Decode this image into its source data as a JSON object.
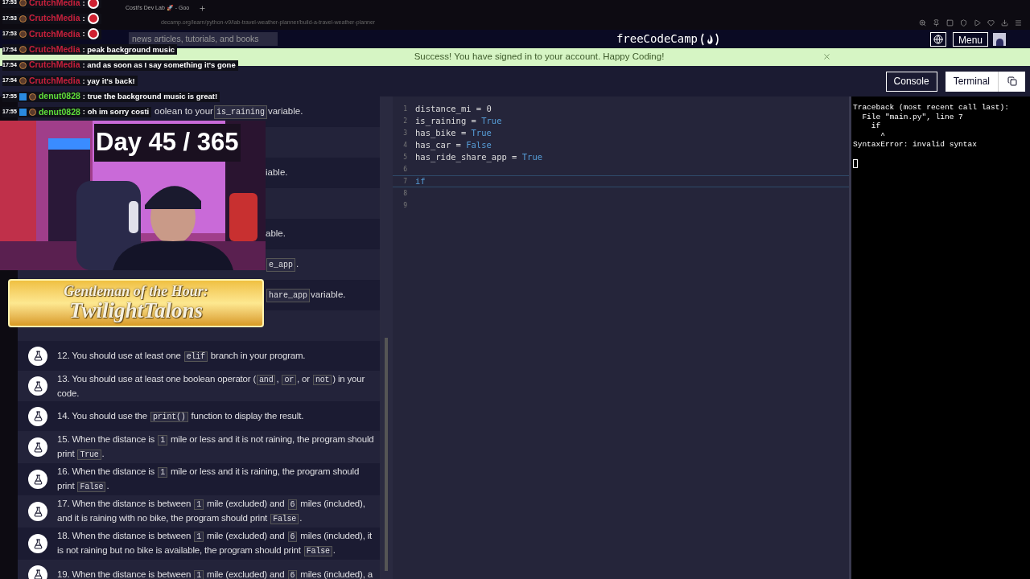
{
  "browser": {
    "tab_title": "Costi's Dev Lab 🚀 - Goo",
    "url": "decamp.org/learn/python-v9/lab-travel-weather-planner/build-a-travel-weather-planner"
  },
  "nav": {
    "search_placeholder": "news articles, tutorials, and books",
    "logo": "freeCodeCamp",
    "menu": "Menu"
  },
  "alert": {
    "text": "Success! You have signed in to your account. Happy Coding!"
  },
  "toolbar": {
    "panels": [
      {
        "label": "Console",
        "selected": false
      },
      {
        "label": "Terminal",
        "selected": true
      }
    ]
  },
  "tests": [
    {
      "kind": "clipped",
      "parts": [
        {
          "text": "oolean to your ",
          "code": false
        },
        {
          "text": "is_raining",
          "code": true
        },
        {
          "text": " variable.",
          "code": false
        }
      ]
    },
    {
      "kind": "covered"
    },
    {
      "kind": "fragment",
      "parts": [
        {
          "text": "iable.",
          "code": false
        }
      ]
    },
    {
      "kind": "covered"
    },
    {
      "kind": "fragment",
      "parts": [
        {
          "text": "able.",
          "code": false
        }
      ]
    },
    {
      "kind": "fragment",
      "parts": [
        {
          "text": "e_app",
          "code": true
        },
        {
          "text": ".",
          "code": false
        }
      ]
    },
    {
      "kind": "fragment",
      "parts": [
        {
          "text": "hare_app",
          "code": true
        },
        {
          "text": " variable.",
          "code": false
        }
      ]
    },
    {
      "kind": "covered"
    },
    {
      "kind": "full",
      "parts": [
        {
          "text": "12. You should use at least one ",
          "code": false
        },
        {
          "text": "elif",
          "code": true
        },
        {
          "text": " branch in your program.",
          "code": false
        }
      ]
    },
    {
      "kind": "full",
      "parts": [
        {
          "text": "13. You should use at least one boolean operator (",
          "code": false
        },
        {
          "text": "and",
          "code": true
        },
        {
          "text": ", ",
          "code": false
        },
        {
          "text": "or",
          "code": true
        },
        {
          "text": ", or ",
          "code": false
        },
        {
          "text": "not",
          "code": true
        },
        {
          "text": ") in your code.",
          "code": false
        }
      ]
    },
    {
      "kind": "full",
      "parts": [
        {
          "text": "14. You should use the ",
          "code": false
        },
        {
          "text": "print()",
          "code": true
        },
        {
          "text": " function to display the result.",
          "code": false
        }
      ]
    },
    {
      "kind": "full",
      "parts": [
        {
          "text": "15. When the distance is ",
          "code": false
        },
        {
          "text": "1",
          "code": true
        },
        {
          "text": " mile or less and it is not raining, the program should print ",
          "code": false
        },
        {
          "text": "True",
          "code": true
        },
        {
          "text": ".",
          "code": false
        }
      ]
    },
    {
      "kind": "full",
      "parts": [
        {
          "text": "16. When the distance is ",
          "code": false
        },
        {
          "text": "1",
          "code": true
        },
        {
          "text": " mile or less and it is raining, the program should print ",
          "code": false
        },
        {
          "text": "False",
          "code": true
        },
        {
          "text": ".",
          "code": false
        }
      ]
    },
    {
      "kind": "full",
      "parts": [
        {
          "text": "17. When the distance is between ",
          "code": false
        },
        {
          "text": "1",
          "code": true
        },
        {
          "text": " mile (excluded) and ",
          "code": false
        },
        {
          "text": "6",
          "code": true
        },
        {
          "text": " miles (included), and it is raining with no bike, the program should print ",
          "code": false
        },
        {
          "text": "False",
          "code": true
        },
        {
          "text": ".",
          "code": false
        }
      ]
    },
    {
      "kind": "full",
      "parts": [
        {
          "text": "18. When the distance is between ",
          "code": false
        },
        {
          "text": "1",
          "code": true
        },
        {
          "text": " mile (excluded) and ",
          "code": false
        },
        {
          "text": "6",
          "code": true
        },
        {
          "text": " miles (included), it is not raining but no bike is available, the program should print ",
          "code": false
        },
        {
          "text": "False",
          "code": true
        },
        {
          "text": ".",
          "code": false
        }
      ]
    },
    {
      "kind": "full",
      "parts": [
        {
          "text": "19. When the distance is between ",
          "code": false
        },
        {
          "text": "1",
          "code": true
        },
        {
          "text": " mile (excluded) and ",
          "code": false
        },
        {
          "text": "6",
          "code": true
        },
        {
          "text": " miles (included), a",
          "code": false
        }
      ]
    }
  ],
  "editor": {
    "lines": [
      {
        "number": "1",
        "active": false,
        "tokens": [
          {
            "text": "distance_mi = 0",
            "kind": "plain"
          }
        ]
      },
      {
        "number": "2",
        "active": false,
        "tokens": [
          {
            "text": "is_raining = ",
            "kind": "plain"
          },
          {
            "text": "True",
            "kind": "constant"
          }
        ]
      },
      {
        "number": "3",
        "active": false,
        "tokens": [
          {
            "text": "has_bike = ",
            "kind": "plain"
          },
          {
            "text": "True",
            "kind": "constant"
          }
        ]
      },
      {
        "number": "4",
        "active": false,
        "tokens": [
          {
            "text": "has_car = ",
            "kind": "plain"
          },
          {
            "text": "False",
            "kind": "constant"
          }
        ]
      },
      {
        "number": "5",
        "active": false,
        "tokens": [
          {
            "text": "has_ride_share_app = ",
            "kind": "plain"
          },
          {
            "text": "True",
            "kind": "constant"
          }
        ]
      },
      {
        "number": "6",
        "active": false
      },
      {
        "number": "7",
        "active": true,
        "tokens": [
          {
            "text": "if",
            "kind": "keyword"
          }
        ]
      },
      {
        "number": "8",
        "active": false
      },
      {
        "number": "9",
        "active": false
      }
    ]
  },
  "terminal": {
    "lines": [
      "Traceback (most recent call last):",
      "  File \"main.py\", line 7",
      "    if",
      "      ^",
      "SyntaxError: invalid syntax"
    ]
  },
  "stream": {
    "chat": [
      {
        "time": "17:53",
        "user": "CrutchMedia",
        "color": "#c8203c",
        "badge": false,
        "emote": true,
        "text": ":"
      },
      {
        "time": "17:53",
        "user": "CrutchMedia",
        "color": "#c8203c",
        "badge": false,
        "emote": true,
        "text": ":"
      },
      {
        "time": "17:53",
        "user": "CrutchMedia",
        "color": "#c8203c",
        "badge": false,
        "emote": true,
        "text": ":"
      },
      {
        "time": "17:54",
        "user": "CrutchMedia",
        "color": "#c8203c",
        "badge": false,
        "emote": false,
        "text": ": peak background music"
      },
      {
        "time": "17:54",
        "user": "CrutchMedia",
        "color": "#c8203c",
        "badge": false,
        "emote": false,
        "text": ": and as soon as I say something it's gone"
      },
      {
        "time": "17:54",
        "user": "CrutchMedia",
        "color": "#c8203c",
        "badge": false,
        "emote": false,
        "text": ": yay it's back!"
      },
      {
        "time": "17:55",
        "user": "denut0828",
        "color": "#5edc3a",
        "badge": true,
        "emote": false,
        "text": ": true the background music is great!"
      },
      {
        "time": "17:55",
        "user": "denut0828",
        "color": "#5edc3a",
        "badge": true,
        "emote": false,
        "text": ": oh im sorry costi"
      }
    ],
    "day": "Day 45 / 365",
    "banner": {
      "title": "Gentleman of the Hour:",
      "name": "TwilightTalons"
    }
  }
}
